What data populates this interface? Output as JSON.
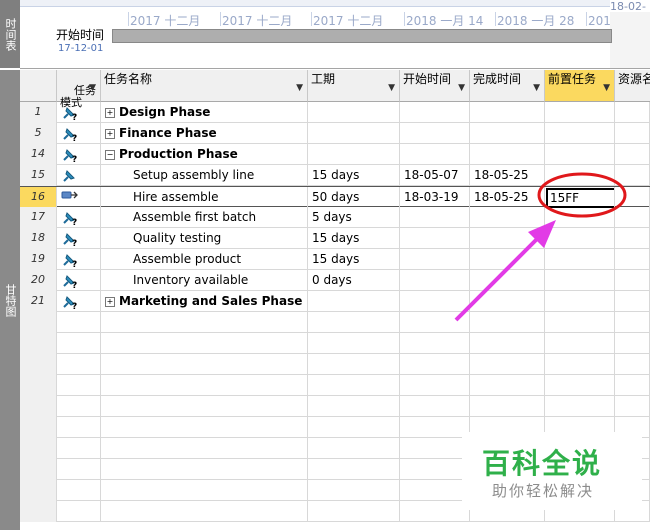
{
  "side_labels": {
    "timeline": "时间表",
    "gantt": "甘特图"
  },
  "timeline": {
    "top_right_date": "18-02-",
    "start_label": "开始时间",
    "start_date": "17-12-01",
    "ticks": [
      "2017 十二月",
      "2017 十二月",
      "2017 十二月",
      "2018 一月 14",
      "2018 一月 28",
      "2018 二月"
    ]
  },
  "columns": {
    "mode": "任务\n模式",
    "name": "任务名称",
    "duration": "工期",
    "start": "开始时间",
    "finish": "完成时间",
    "predecessors": "前置任务",
    "resources": "资源名"
  },
  "rows": [
    {
      "id": "1",
      "name": "Design Phase",
      "summary": true,
      "expander": "+",
      "duration": "",
      "start": "",
      "finish": "",
      "pred": ""
    },
    {
      "id": "5",
      "name": "Finance Phase",
      "summary": true,
      "expander": "+",
      "duration": "",
      "start": "",
      "finish": "",
      "pred": ""
    },
    {
      "id": "14",
      "name": "Production Phase",
      "summary": true,
      "expander": "−",
      "duration": "",
      "start": "",
      "finish": "",
      "pred": ""
    },
    {
      "id": "15",
      "name": "Setup assembly line",
      "summary": false,
      "expander": "",
      "duration": "15 days",
      "start": "18-05-07",
      "finish": "18-05-25",
      "pred": ""
    },
    {
      "id": "16",
      "name": "Hire assemble",
      "summary": false,
      "expander": "",
      "duration": "50 days",
      "start": "18-03-19",
      "finish": "18-05-25",
      "pred": "15FF"
    },
    {
      "id": "17",
      "name": "Assemble first batch",
      "summary": false,
      "expander": "",
      "duration": "5 days",
      "start": "",
      "finish": "",
      "pred": ""
    },
    {
      "id": "18",
      "name": "Quality testing",
      "summary": false,
      "expander": "",
      "duration": "15 days",
      "start": "",
      "finish": "",
      "pred": ""
    },
    {
      "id": "19",
      "name": "Assemble product",
      "summary": false,
      "expander": "",
      "duration": "15 days",
      "start": "",
      "finish": "",
      "pred": ""
    },
    {
      "id": "20",
      "name": "Inventory available",
      "summary": false,
      "expander": "",
      "duration": "0 days",
      "start": "",
      "finish": "",
      "pred": ""
    },
    {
      "id": "21",
      "name": "Marketing and Sales Phase",
      "summary": true,
      "expander": "+",
      "duration": "",
      "start": "",
      "finish": "",
      "pred": ""
    }
  ],
  "watermark": {
    "title": "百科全说",
    "subtitle": "助你轻松解决"
  },
  "colors": {
    "selected_header": "#fbd95f",
    "annotation": "#e0181b",
    "arrow": "#e23be6",
    "watermark_green": "#2fb04a"
  }
}
